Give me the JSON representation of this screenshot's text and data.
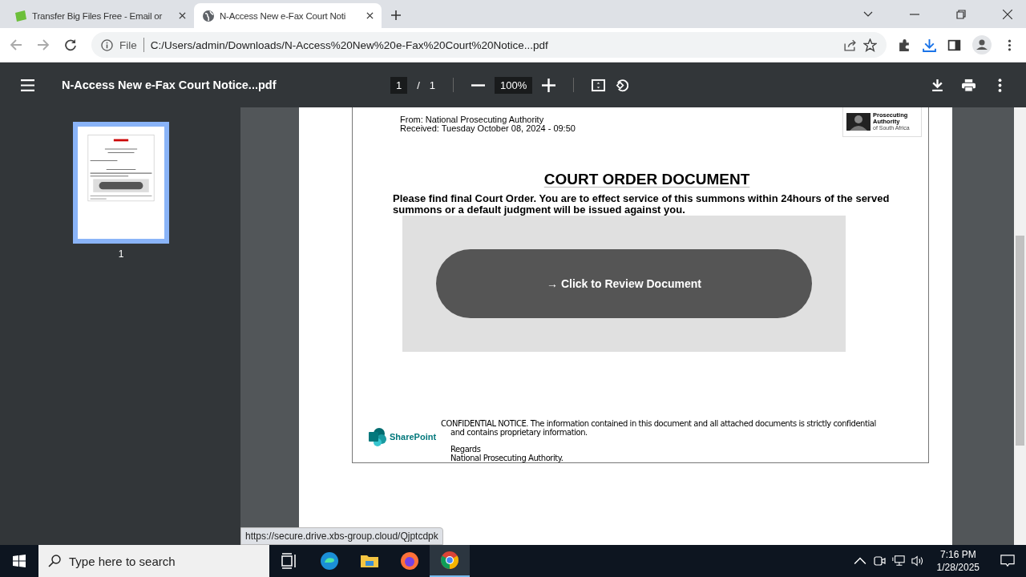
{
  "browser": {
    "tabs": [
      {
        "title": "Transfer Big Files Free - Email or",
        "kind": "big",
        "selected": false
      },
      {
        "title": "N-Access New e-Fax Court Noti",
        "kind": "globe",
        "selected": true
      }
    ],
    "address": {
      "scheme": "File",
      "url": "C:/Users/admin/Downloads/N-Access%20New%20e-Fax%20Court%20Notice...pdf"
    }
  },
  "pdf_toolbar": {
    "title": "N-Access New e-Fax Court Notice...pdf",
    "page": "1",
    "separator": "/",
    "page_count": "1",
    "zoom": "100%"
  },
  "thumbnails": [
    {
      "label": "1",
      "selected": true
    }
  ],
  "document": {
    "from": "From: National Prosecuting Authority",
    "received": "Received: Tuesday October 08, 2024 - 09:50",
    "logo_lines": [
      "Prosecuting",
      "Authority",
      "of South Africa"
    ],
    "heading": "COURT ORDER DOCUMENT",
    "message": "Please find final Court Order.  You are to effect service of this summons within 24hours of the served summons or a default judgment will be issued against you.",
    "button": "→ Click to Review Document",
    "brand": "SharePoint",
    "notice_lines": [
      "CONFIDENTIAL NOTICE. The information contained in this document and all attached documents is strictly confidential",
      "and contains proprietary information."
    ],
    "regards": "Regards",
    "signature": "National Prosecuting Authority."
  },
  "status_link": "https://secure.drive.xbs-group.cloud/Qjptcdpk",
  "taskbar": {
    "search_placeholder": "Type here to search",
    "apps": [
      {
        "kind": "taskview",
        "selected": false
      },
      {
        "kind": "edge",
        "selected": false
      },
      {
        "kind": "explorer",
        "selected": false
      },
      {
        "kind": "firefox",
        "selected": false
      },
      {
        "kind": "chrome",
        "selected": true
      }
    ],
    "time": "7:16 PM",
    "date": "1/28/2025"
  }
}
